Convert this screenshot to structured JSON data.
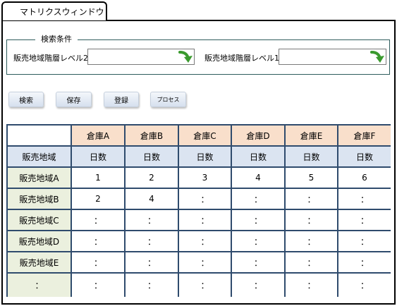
{
  "window": {
    "tab_title": "マトリクスウィンドウ"
  },
  "search": {
    "legend": "検索条件",
    "level2_label": "販売地域階層レベル2",
    "level1_label": "販売地域階層レベル1",
    "level2_value": "",
    "level1_value": ""
  },
  "buttons": [
    "検索",
    "保存",
    "登録",
    "プロセス"
  ],
  "matrix": {
    "warehouses": [
      "倉庫A",
      "倉庫B",
      "倉庫C",
      "倉庫D",
      "倉庫E",
      "倉庫F"
    ],
    "region_header": "販売地域",
    "sub_header": "日数",
    "rows": [
      {
        "region": "販売地域A",
        "values": [
          "1",
          "2",
          "3",
          "4",
          "5",
          "6"
        ]
      },
      {
        "region": "販売地域B",
        "values": [
          "2",
          "4",
          "：",
          "：",
          "：",
          "："
        ]
      },
      {
        "region": "販売地域C",
        "values": [
          "：",
          "：",
          "：",
          "：",
          "：",
          "："
        ]
      },
      {
        "region": "販売地域D",
        "values": [
          "：",
          "：",
          "：",
          "：",
          "：",
          "："
        ]
      },
      {
        "region": "販売地域E",
        "values": [
          "：",
          "：",
          "：",
          "：",
          "：",
          "："
        ]
      },
      {
        "region": "：",
        "values": [
          "：",
          "：",
          "：",
          "：",
          "：",
          "："
        ]
      }
    ]
  },
  "colors": {
    "grid_border": "#2f4b6d",
    "warehouse_header_bg": "#f9dfcb",
    "sub_header_bg": "#dbe4f1",
    "region_cell_bg": "#ebf0de",
    "go_arrow": "#3a9a2e"
  },
  "icons": {
    "go": "green-curved-arrow-icon"
  }
}
